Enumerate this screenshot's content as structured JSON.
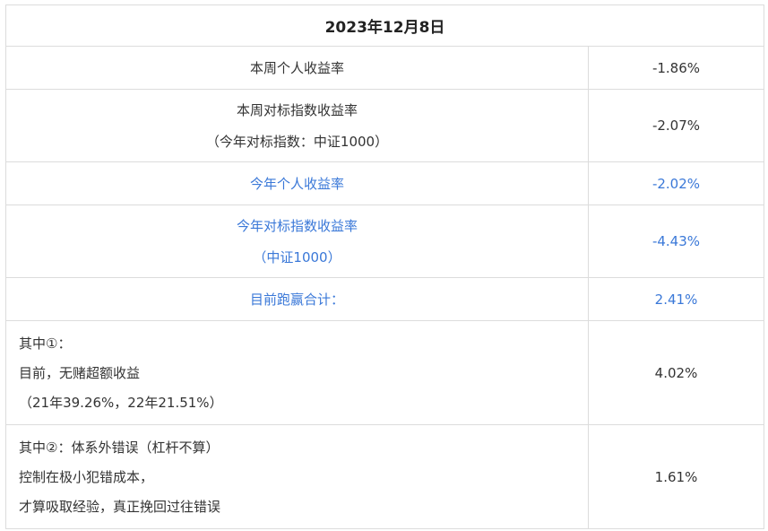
{
  "title": "2023年12月8日",
  "rows": [
    {
      "label_lines": [
        "本周个人收益率"
      ],
      "value": "-1.86%"
    },
    {
      "label_lines": [
        "本周对标指数收益率",
        "（今年对标指数：中证1000）"
      ],
      "value": "-2.07%"
    },
    {
      "label_lines": [
        "今年个人收益率"
      ],
      "value": "-2.02%"
    },
    {
      "label_lines": [
        "今年对标指数收益率",
        "（中证1000）"
      ],
      "value": "-4.43%"
    },
    {
      "label_lines": [
        "目前跑赢合计："
      ],
      "value": "2.41%"
    },
    {
      "label_lines": [
        "其中①：",
        "目前，无赌超额收益",
        "（21年39.26%，22年21.51%）"
      ],
      "value": "4.02%"
    },
    {
      "label_lines": [
        "其中②：体系外错误（杠杆不算）",
        "控制在极小犯错成本，",
        "才算吸取经验，真正挽回过往错误"
      ],
      "value": "1.61%"
    }
  ],
  "colors": {
    "text": "#333333",
    "accent_blue": "#3a78d8",
    "border": "#dcdcdc"
  }
}
